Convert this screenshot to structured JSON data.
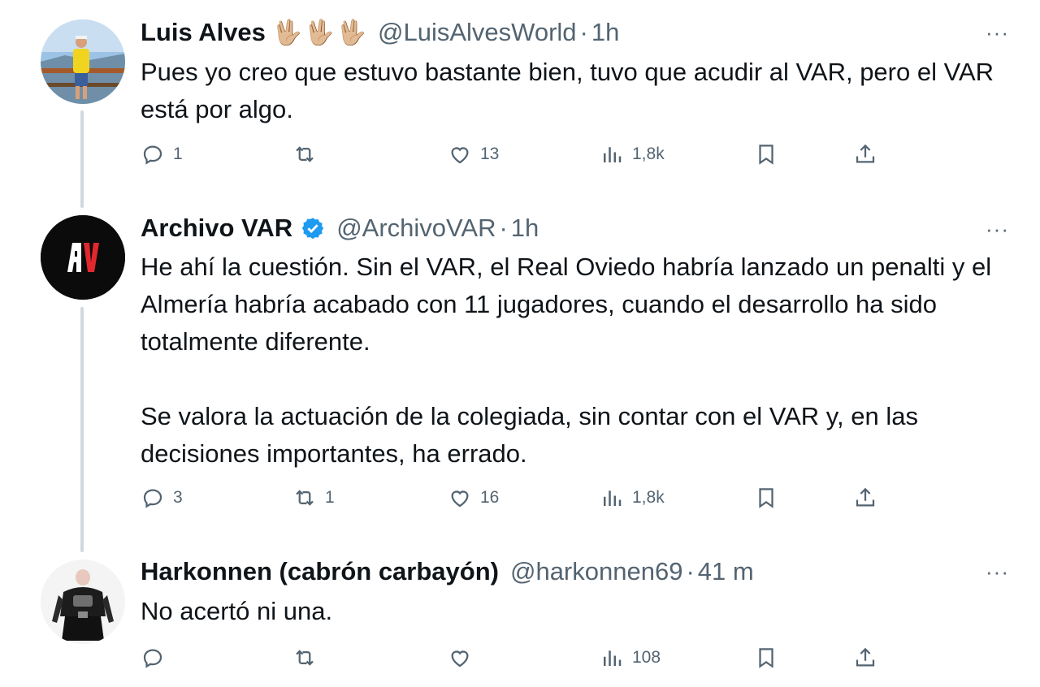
{
  "tweets": [
    {
      "name": "Luis Alves",
      "emoji": [
        "🖖🏼",
        "🖖🏼",
        "🖖🏼"
      ],
      "verified": false,
      "handle": "@LuisAlvesWorld",
      "dot": "·",
      "time": "1h",
      "text": [
        "Pues yo creo que estuvo bastante bien, tuvo que acudir al VAR, pero el VAR está por algo."
      ],
      "replies": "1",
      "retweets": "",
      "likes": "13",
      "views": "1,8k"
    },
    {
      "name": "Archivo VAR",
      "avatar_text": "AV",
      "verified": true,
      "handle": "@ArchivoVAR",
      "dot": "·",
      "time": "1h",
      "text": [
        "He ahí la cuestión. Sin el VAR, el Real Oviedo habría lanzado un penalti y el Almería habría acabado con 11 jugadores, cuando el desarrollo ha sido totalmente diferente.",
        "Se valora la actuación de la colegiada, sin contar con el VAR y, en las decisiones importantes, ha errado."
      ],
      "replies": "3",
      "retweets": "1",
      "likes": "16",
      "views": "1,8k"
    },
    {
      "name": "Harkonnen (cabrón carbayón)",
      "verified": false,
      "handle": "@harkonnen69",
      "dot": "·",
      "time": "41 m",
      "text": [
        "No acertó ni una."
      ],
      "replies": "",
      "retweets": "",
      "likes": "",
      "views": "108"
    }
  ],
  "more_label": "···",
  "colors": {
    "verified": "#1d9bf0",
    "muted": "#536471",
    "line": "#cfd9de"
  },
  "icons": [
    "reply-icon",
    "retweet-icon",
    "like-icon",
    "views-icon",
    "bookmark-icon",
    "share-icon"
  ]
}
